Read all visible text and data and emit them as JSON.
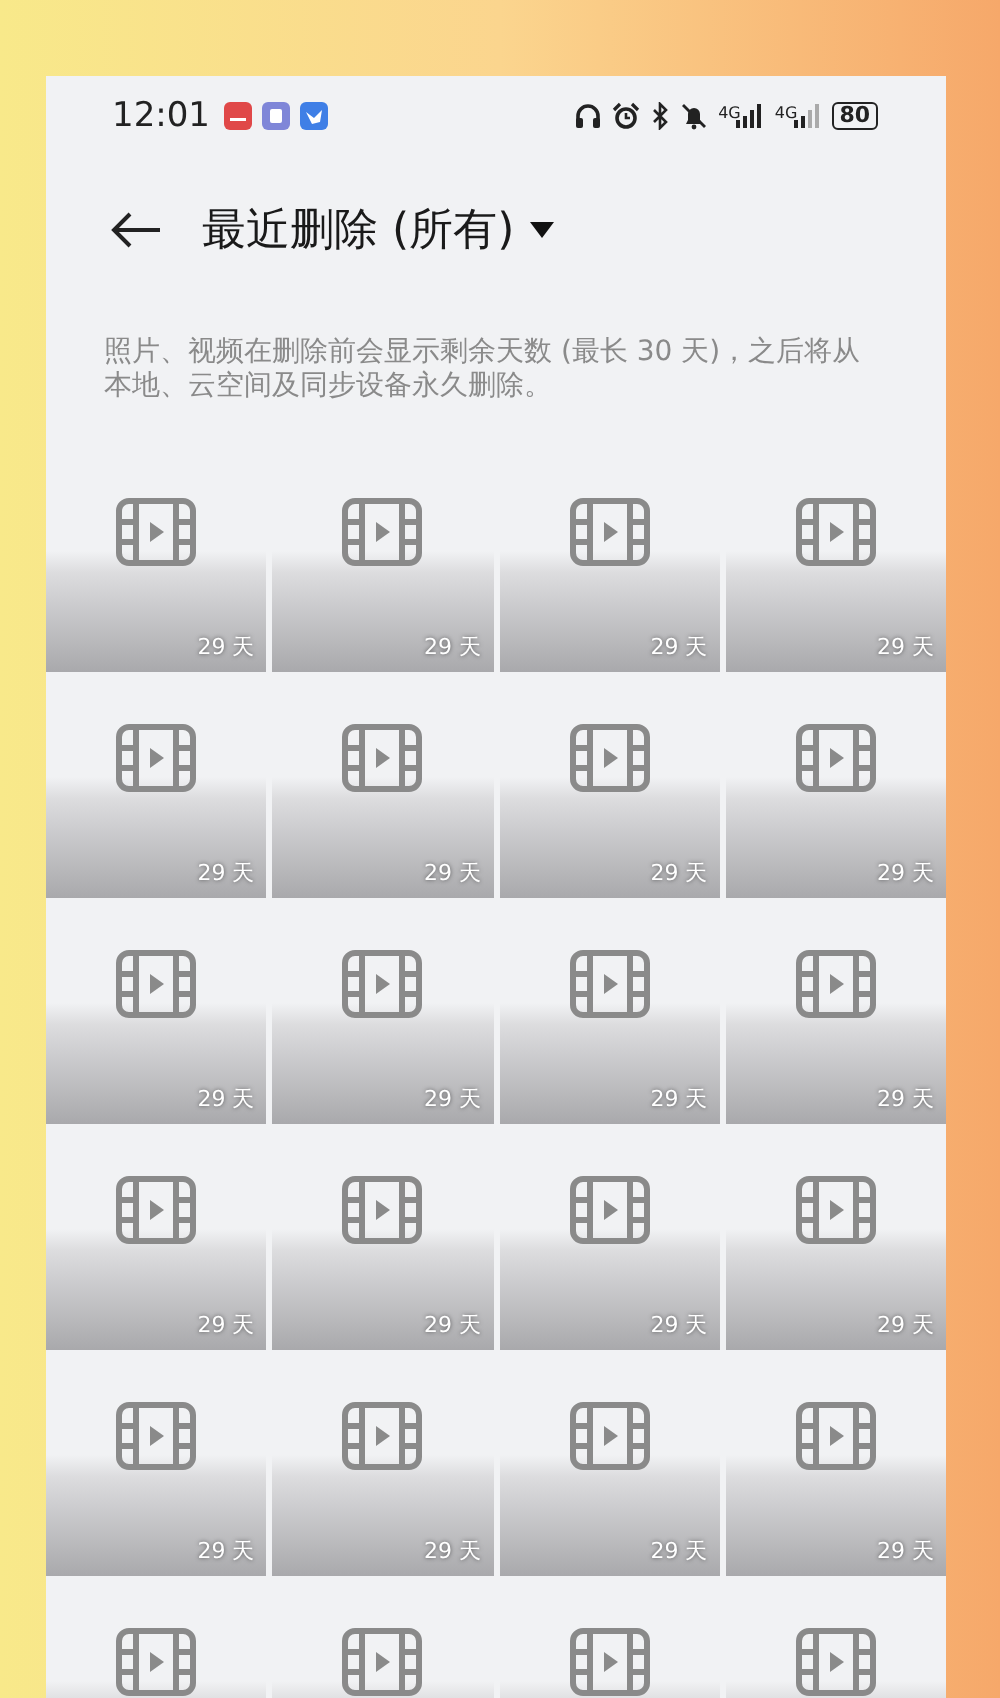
{
  "status_bar": {
    "time": "12:01",
    "networks": [
      {
        "label": "4G",
        "strong": true
      },
      {
        "label": "4G",
        "strong": false
      }
    ],
    "battery": "80"
  },
  "header": {
    "title": "最近删除 (所有)"
  },
  "description": "照片、视频在删除前会显示剩余天数 (最长 30 天)，之后将从本地、云空间及同步设备永久删除。",
  "tiles": [
    {
      "kind": "video",
      "days": "29 天"
    },
    {
      "kind": "video",
      "days": "29 天"
    },
    {
      "kind": "video",
      "days": "29 天"
    },
    {
      "kind": "video",
      "days": "29 天"
    },
    {
      "kind": "video",
      "days": "29 天"
    },
    {
      "kind": "video",
      "days": "29 天"
    },
    {
      "kind": "video",
      "days": "29 天"
    },
    {
      "kind": "video",
      "days": "29 天"
    },
    {
      "kind": "video",
      "days": "29 天"
    },
    {
      "kind": "video",
      "days": "29 天"
    },
    {
      "kind": "video",
      "days": "29 天"
    },
    {
      "kind": "video",
      "days": "29 天"
    },
    {
      "kind": "video",
      "days": "29 天"
    },
    {
      "kind": "video",
      "days": "29 天"
    },
    {
      "kind": "video",
      "days": "29 天"
    },
    {
      "kind": "video",
      "days": "29 天"
    },
    {
      "kind": "video",
      "days": "29 天"
    },
    {
      "kind": "video",
      "days": "29 天"
    },
    {
      "kind": "video",
      "days": "29 天"
    },
    {
      "kind": "video",
      "days": "29 天"
    },
    {
      "kind": "video"
    },
    {
      "kind": "video"
    },
    {
      "kind": "video"
    },
    {
      "kind": "video"
    }
  ]
}
